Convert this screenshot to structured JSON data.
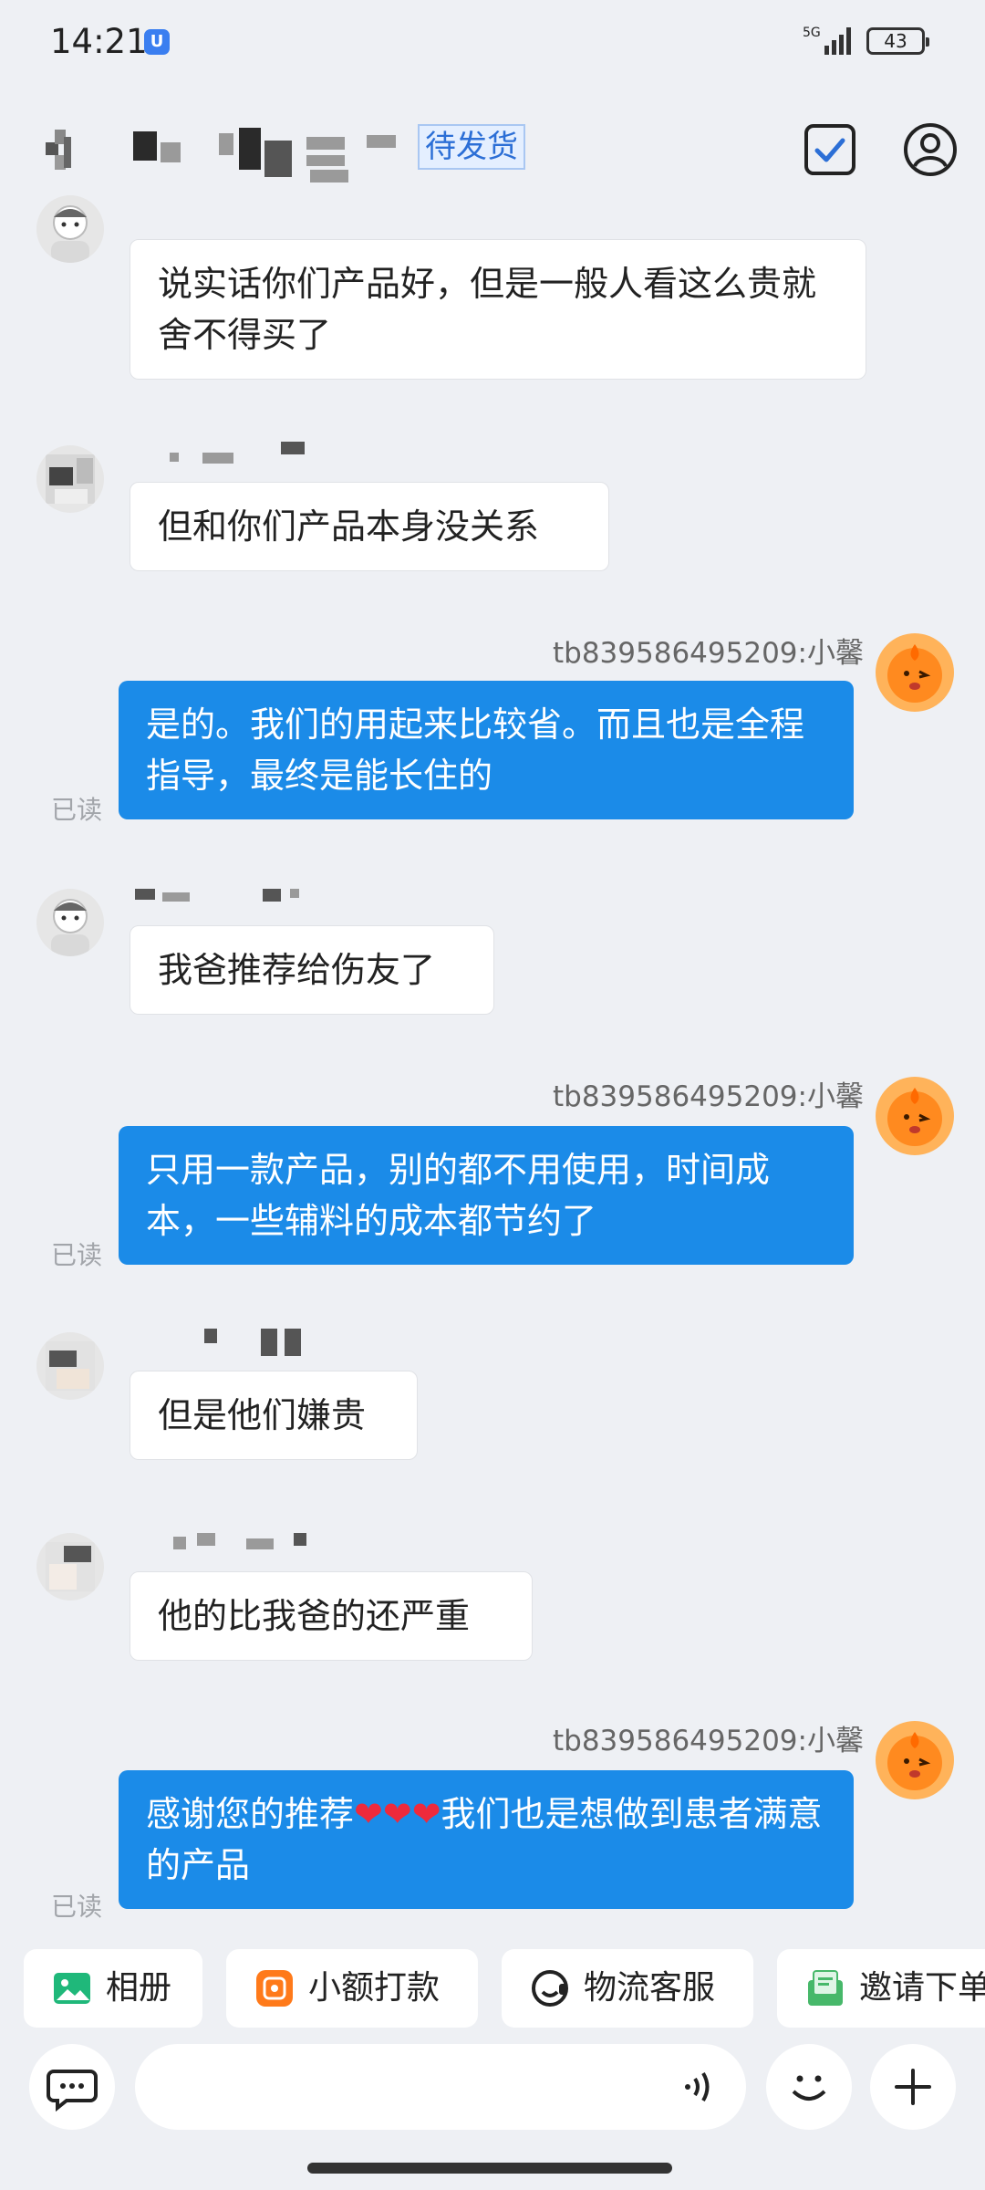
{
  "status_bar": {
    "time": "14:21",
    "notification_badge": "U",
    "network": "5G",
    "battery": "43"
  },
  "header": {
    "order_status_tag": "待发货"
  },
  "messages": [
    {
      "side": "in",
      "text": "说实话你们产品好，但是一般人看这么贵就舍不得买了"
    },
    {
      "side": "in",
      "text": "但和你们产品本身没关系"
    },
    {
      "side": "out",
      "sender": "tb839586495209:小馨",
      "text": "是的。我们的用起来比较省。而且也是全程指导，最终是能长住的",
      "read": "已读"
    },
    {
      "side": "in",
      "text": "我爸推荐给伤友了"
    },
    {
      "side": "out",
      "sender": "tb839586495209:小馨",
      "text": "只用一款产品，别的都不用使用，时间成本，一些辅料的成本都节约了",
      "read": "已读"
    },
    {
      "side": "in",
      "text": "但是他们嫌贵"
    },
    {
      "side": "in",
      "text": "他的比我爸的还严重"
    },
    {
      "side": "out",
      "sender": "tb839586495209:小馨",
      "text_before": "感谢您的推荐",
      "hearts": "❤❤❤",
      "text_after": "我们也是想做到患者满意的产品",
      "read": "已读"
    }
  ],
  "quick_actions": [
    {
      "label": "相册",
      "icon": "photo-album-icon"
    },
    {
      "label": "小额打款",
      "icon": "small-payment-icon"
    },
    {
      "label": "物流客服",
      "icon": "logistics-service-icon"
    },
    {
      "label": "邀请下单",
      "icon": "invite-order-icon"
    }
  ],
  "input_bar": {
    "placeholder": ""
  },
  "colors": {
    "outgoing_bubble": "#1b8be8",
    "incoming_bubble": "#ffffff",
    "background": "#eef0f4",
    "accent": "#2c6fd6"
  }
}
